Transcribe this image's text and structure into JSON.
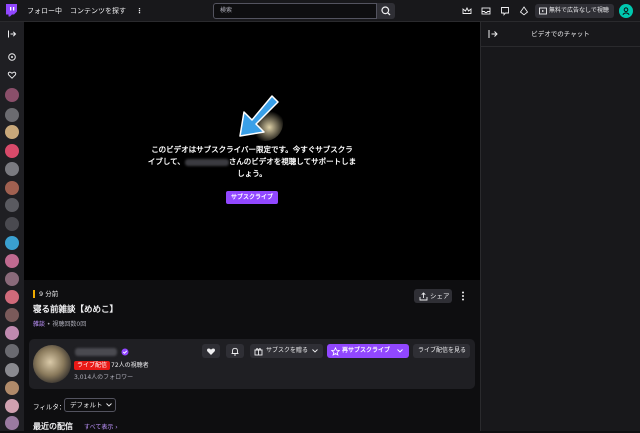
{
  "topbar": {
    "following": "フォロー中",
    "browse": "コンテンツを探す",
    "search_placeholder": "検索",
    "adfree_label": "無料で広告なしで視聴"
  },
  "video": {
    "message_line1": "このビデオはサブスクライバー限定です。今すぐサブスクラ",
    "message_line2_prefix": "イブして、",
    "message_line2_suffix": "さんのビデオを視聴してサポートしま",
    "message_line3": "しょう。",
    "subscribe_button": "サブスクライブ"
  },
  "info": {
    "duration": "9 分前",
    "title": "寝る前雑談【めめこ】",
    "category": "雑談",
    "views": "視聴回数0回",
    "share_label": "シェア"
  },
  "channel": {
    "live_badge": "ライブ配信",
    "viewers": "72人の視聴者",
    "followers": "3,014人のフォロワー",
    "gift_sub_label": "サブスクを贈る",
    "resub_label": "再サブスクライブ",
    "watch_live_label": "ライブ配信を見る"
  },
  "filter": {
    "label": "フィルタ：",
    "selected": "デフォルト"
  },
  "recent": {
    "heading": "最近の配信",
    "show_all": "すべて表示 ›"
  },
  "chat": {
    "title": "ビデオでのチャット"
  },
  "colors": {
    "accent": "#9147ff",
    "live": "#e91916",
    "link": "#bf94ff"
  }
}
